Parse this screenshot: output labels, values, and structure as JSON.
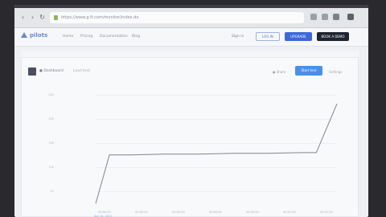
{
  "browser": {
    "url": "https://www.g.ft.com/monitor/index.do"
  },
  "header": {
    "brand": "pilots",
    "nav": [
      "Home",
      "Pricing",
      "Documentation",
      "Blog"
    ],
    "signin": "Sign in",
    "btn_outline": "LOG IN",
    "btn_primary": "UPGRADE",
    "btn_dark": "BOOK A DEMO"
  },
  "card": {
    "title": "● Dashboard",
    "subtitle": "Load test",
    "link_left": "● Share",
    "primary_button": "Start test",
    "link_right": "Settings"
  },
  "chart_data": {
    "type": "line",
    "y_ticks": [
      "250",
      "200",
      "150",
      "100",
      "50"
    ],
    "x_ticks": [
      "00:00:10",
      "00:00:20",
      "00:00:30",
      "00:00:40",
      "00:00:50",
      "00:01:00",
      "00:01:10"
    ],
    "x_sub": "Apr 14, 2017",
    "series": [
      {
        "x": [
          0,
          4,
          10,
          20,
          30,
          40,
          50,
          60,
          64,
          70
        ],
        "values": [
          5,
          70,
          70,
          71,
          71,
          72,
          72,
          73,
          73,
          138
        ]
      }
    ],
    "ylim": [
      0,
      150
    ],
    "xlim": [
      0,
      70
    ],
    "grid": true
  }
}
